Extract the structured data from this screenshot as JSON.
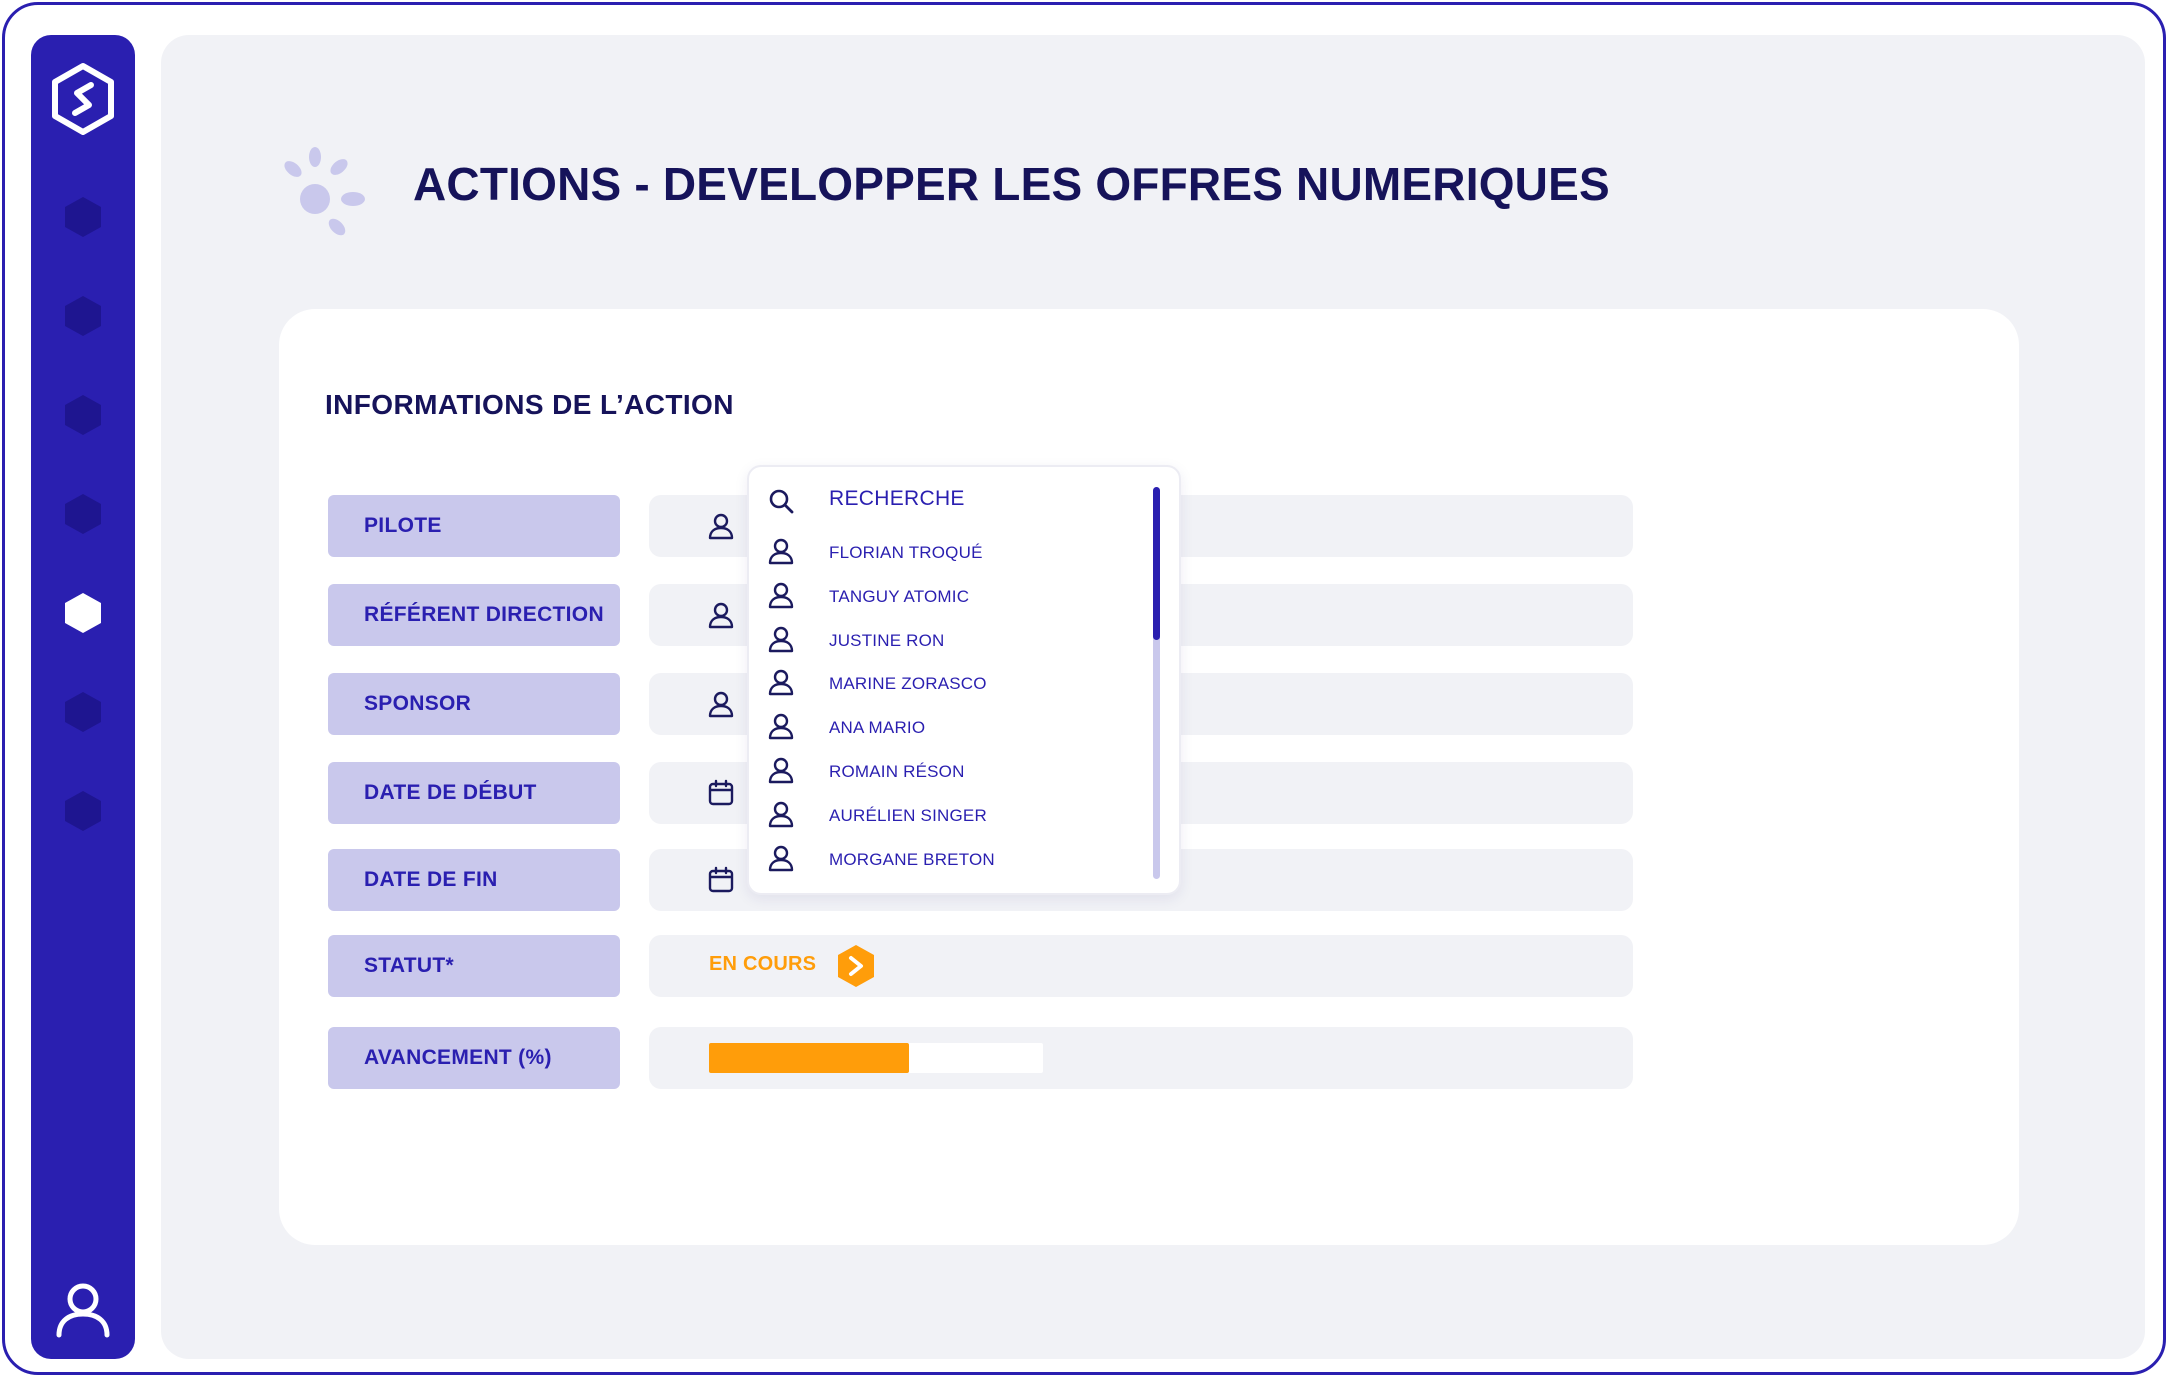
{
  "page": {
    "title_strong": "ACTIONS -",
    "title_rest": "DEVELOPPER LES OFFRES NUMERIQUES"
  },
  "sidebar": {
    "logo_icon": "hexagon-s-logo-icon",
    "nav_items": [
      {
        "icon": "hexagon-icon",
        "active": false
      },
      {
        "icon": "hexagon-icon",
        "active": false
      },
      {
        "icon": "hexagon-icon",
        "active": false
      },
      {
        "icon": "hexagon-icon",
        "active": false
      },
      {
        "icon": "hexagon-icon",
        "active": true
      },
      {
        "icon": "hexagon-icon",
        "active": false
      },
      {
        "icon": "hexagon-icon",
        "active": false
      }
    ],
    "user_icon": "user-icon"
  },
  "card": {
    "title": "INFORMATIONS DE L’ACTION",
    "fields": [
      {
        "label": "PILOTE",
        "icon": "user-icon"
      },
      {
        "label": "RÉFÉRENT DIRECTION",
        "icon": "user-icon"
      },
      {
        "label": "SPONSOR",
        "icon": "user-icon"
      },
      {
        "label": "DATE DE DÉBUT",
        "icon": "calendar-icon"
      },
      {
        "label": "DATE DE FIN",
        "icon": "calendar-icon"
      },
      {
        "label": "STATUT*",
        "value": "EN COURS",
        "badge_icon": "chevron-right-icon"
      },
      {
        "label": "AVANCEMENT (%)",
        "progress_percent": 60
      }
    ]
  },
  "dropdown": {
    "search_placeholder": "RECHERCHE",
    "search_icon": "search-icon",
    "items": [
      "FLORIAN TROQUÉ",
      "TANGUY ATOMIC",
      "JUSTINE RON",
      "MARINE ZORASCO",
      "ANA MARIO",
      "ROMAIN RÉSON",
      "AURÉLIEN SINGER",
      "MORGANE BRETON"
    ],
    "scroll_fraction": 0.39
  },
  "colors": {
    "primary": "#2a1fb0",
    "label_bg": "#c9c8ec",
    "accent": "#ff9d0a",
    "background": "#f1f2f6",
    "title": "#16135a"
  }
}
